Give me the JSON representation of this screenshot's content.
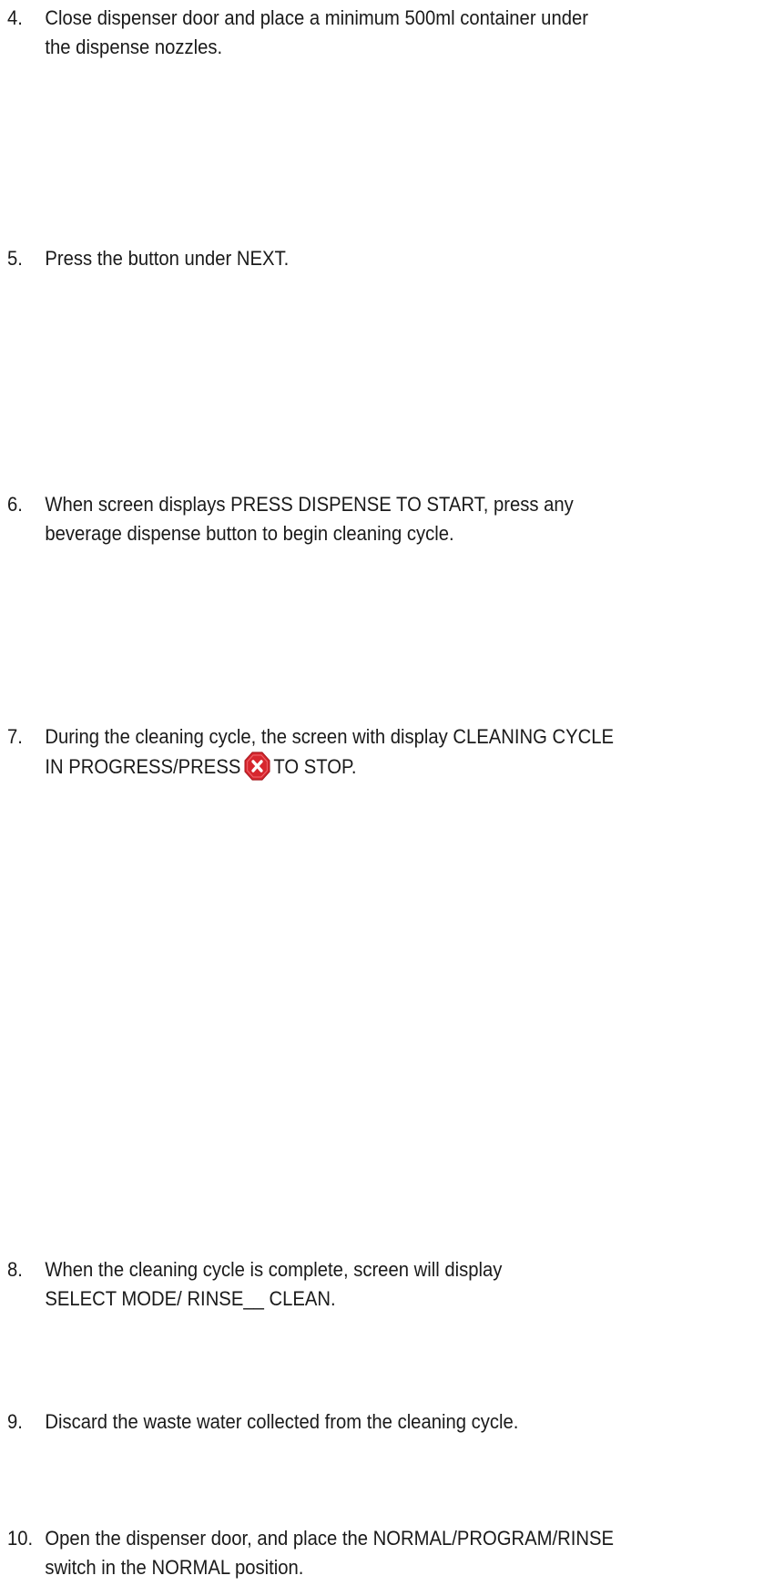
{
  "steps": [
    {
      "number": "4.",
      "line1": "Close dispenser door and place a minimum 500ml container under",
      "line2": "the dispense nozzles."
    },
    {
      "number": "5.",
      "line1": "Press the button under NEXT."
    },
    {
      "number": "6.",
      "line1": "When screen displays PRESS DISPENSE TO START, press any",
      "line2": "beverage dispense button to begin cleaning cycle."
    },
    {
      "number": "7.",
      "line1": "During the cleaning cycle, the screen with display CLEANING CYCLE",
      "line2_before_icon": "IN PROGRESS/PRESS",
      "line2_after_icon": "TO STOP.",
      "icon": "stop-x-octagon-icon",
      "icon_color": "#d7262e"
    },
    {
      "number": "8.",
      "line1": "When the cleaning cycle is complete, screen will display",
      "line2": "SELECT MODE/ RINSE__ CLEAN."
    },
    {
      "number": "9.",
      "line1": "Discard the waste water collected from the cleaning cycle."
    },
    {
      "number": "10.",
      "line1": "Open the dispenser door, and place the NORMAL/PROGRAM/RINSE",
      "line2": "switch in the NORMAL position."
    }
  ]
}
